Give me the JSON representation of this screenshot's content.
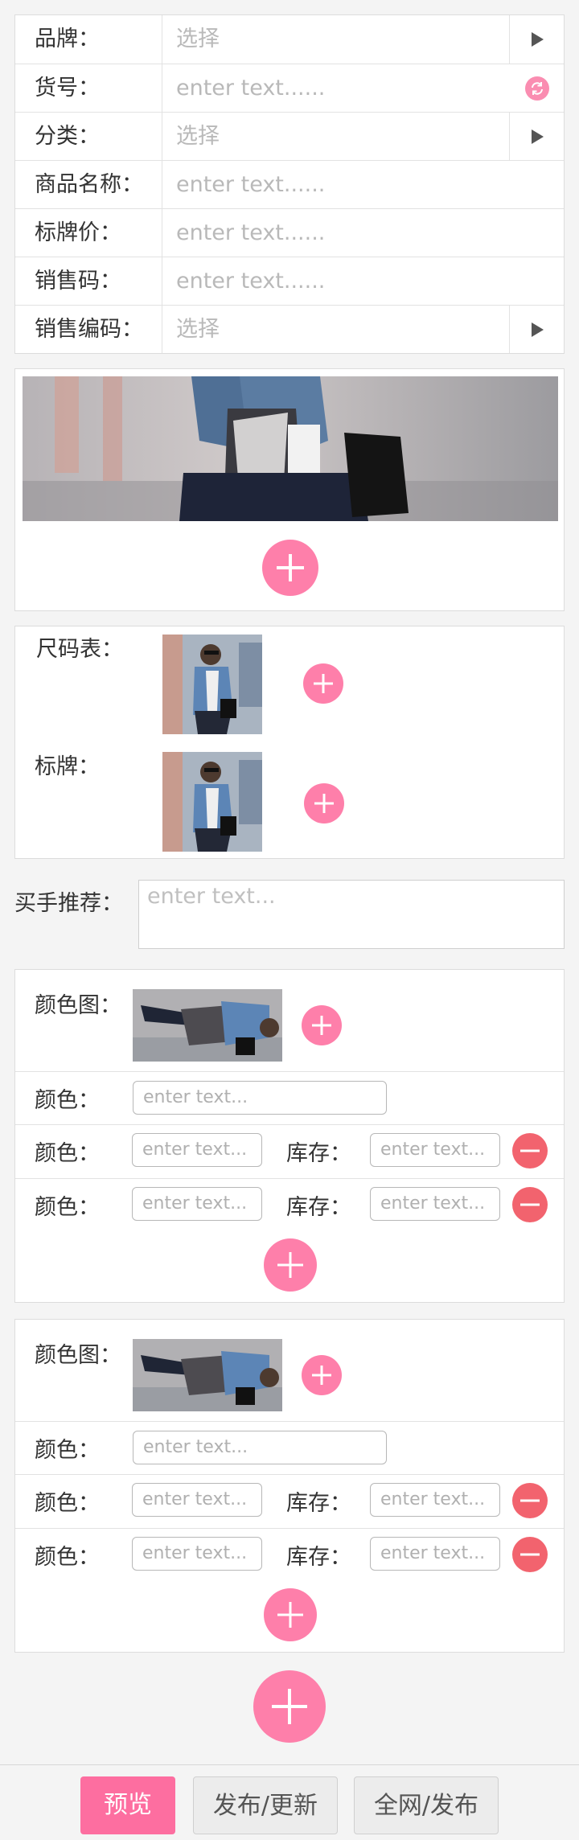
{
  "form": {
    "brand": {
      "label": "品牌：",
      "value": "选择"
    },
    "item_no": {
      "label": "货号：",
      "placeholder": "enter text......"
    },
    "category": {
      "label": "分类：",
      "value": "选择"
    },
    "product_name": {
      "label": "商品名称：",
      "placeholder": "enter text......"
    },
    "tag_price": {
      "label": "标牌价：",
      "placeholder": "enter text......"
    },
    "sale_code": {
      "label": "销售码：",
      "placeholder": "enter text......"
    },
    "sale_encoding": {
      "label": "销售编码：",
      "value": "选择"
    }
  },
  "size_chart": {
    "label": "尺码表："
  },
  "brand_tag": {
    "label": "标牌："
  },
  "buyer_recommend": {
    "label": "买手推荐：",
    "placeholder": "enter text..."
  },
  "color_groups": [
    {
      "image_label": "颜色图：",
      "color_label": "颜色：",
      "color_placeholder": "enter text...",
      "rows": [
        {
          "color_label": "颜色：",
          "color_placeholder": "enter text...",
          "stock_label": "库存：",
          "stock_placeholder": "enter text..."
        },
        {
          "color_label": "颜色：",
          "color_placeholder": "enter text...",
          "stock_label": "库存：",
          "stock_placeholder": "enter text..."
        }
      ]
    },
    {
      "image_label": "颜色图：",
      "color_label": "颜色：",
      "color_placeholder": "enter text...",
      "rows": [
        {
          "color_label": "颜色：",
          "color_placeholder": "enter text...",
          "stock_label": "库存：",
          "stock_placeholder": "enter text..."
        },
        {
          "color_label": "颜色：",
          "color_placeholder": "enter text...",
          "stock_label": "库存：",
          "stock_placeholder": "enter text..."
        }
      ]
    }
  ],
  "bottom_bar": {
    "preview": "预览",
    "publish_update": "发布/更新",
    "publish_all": "全网/发布"
  },
  "colors": {
    "accent": "#fe7faa",
    "remove": "#f2636e",
    "primary_button": "#fd6ea0"
  }
}
